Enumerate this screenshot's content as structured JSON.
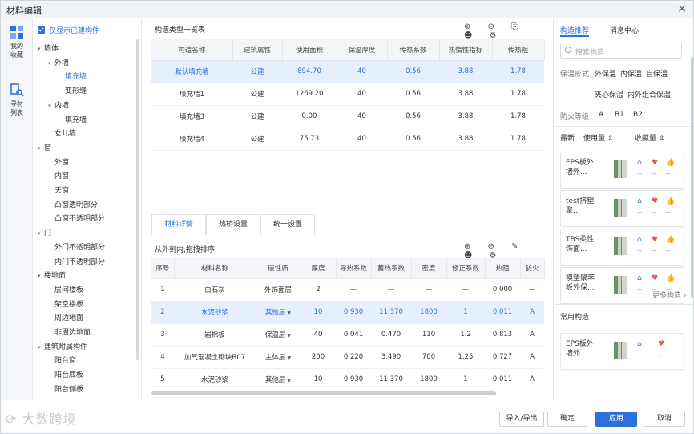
{
  "window": {
    "title": "材料编辑",
    "close": "×"
  },
  "rail": [
    {
      "label1": "我的",
      "label2": "收藏"
    },
    {
      "label1": "寻材",
      "label2": "列表"
    }
  ],
  "tree": {
    "only_built": "仅显示已建构件",
    "nodes": [
      {
        "label": "墙体",
        "level": 0,
        "expand": "▾"
      },
      {
        "label": "外墙",
        "level": 1,
        "expand": "▾"
      },
      {
        "label": "填充墙",
        "level": 2,
        "expand": "",
        "selected": true
      },
      {
        "label": "变形缝",
        "level": 2,
        "expand": ""
      },
      {
        "label": "内墙",
        "level": 1,
        "expand": "▾"
      },
      {
        "label": "填充墙",
        "level": 2,
        "expand": ""
      },
      {
        "label": "女儿墙",
        "level": 1,
        "expand": ""
      },
      {
        "label": "窗",
        "level": 0,
        "expand": "▾"
      },
      {
        "label": "外窗",
        "level": 1,
        "expand": ""
      },
      {
        "label": "内窗",
        "level": 1,
        "expand": ""
      },
      {
        "label": "天窗",
        "level": 1,
        "expand": ""
      },
      {
        "label": "凸窗透明部分",
        "level": 1,
        "expand": ""
      },
      {
        "label": "凸窗不透明部分",
        "level": 1,
        "expand": ""
      },
      {
        "label": "门",
        "level": 0,
        "expand": "▾"
      },
      {
        "label": "外门不透明部分",
        "level": 1,
        "expand": ""
      },
      {
        "label": "内门不透明部分",
        "level": 1,
        "expand": ""
      },
      {
        "label": "楼地面",
        "level": 0,
        "expand": "▾"
      },
      {
        "label": "层间楼板",
        "level": 1,
        "expand": ""
      },
      {
        "label": "架空楼板",
        "level": 1,
        "expand": ""
      },
      {
        "label": "周边地面",
        "level": 1,
        "expand": ""
      },
      {
        "label": "非周边地面",
        "level": 1,
        "expand": ""
      },
      {
        "label": "建筑附属构件",
        "level": 0,
        "expand": "▾"
      },
      {
        "label": "阳台窗",
        "level": 1,
        "expand": ""
      },
      {
        "label": "阳台底板",
        "level": 1,
        "expand": ""
      },
      {
        "label": "阳台侧板",
        "level": 1,
        "expand": ""
      }
    ]
  },
  "types": {
    "title": "构造类型一览表",
    "tools": "⊕ ⊖ ⎘ ☻ ⚙",
    "headers": [
      "构造名称",
      "建筑属性",
      "使用面积",
      "保温厚度",
      "传热系数",
      "热惰性指标",
      "传热阻"
    ],
    "rows": [
      [
        "默认填充墙",
        "公建",
        "894.70",
        "40",
        "0.56",
        "3.88",
        "1.78"
      ],
      [
        "填充墙1",
        "公建",
        "1269.20",
        "40",
        "0.56",
        "3.88",
        "1.78"
      ],
      [
        "填充墙3",
        "公建",
        "0.00",
        "40",
        "0.56",
        "3.88",
        "1.78"
      ],
      [
        "填充墙4",
        "公建",
        "75.73",
        "40",
        "0.56",
        "3.88",
        "1.78"
      ]
    ],
    "highlight": 0
  },
  "tabs": [
    "材料详情",
    "热桥设置",
    "统一设置"
  ],
  "layers": {
    "title": "从外到内,拖拽排序",
    "tools": "⊕ ⊖ ✎ ☻ ⚙",
    "headers": [
      "序号",
      "材料名称",
      "层性质",
      "厚度",
      "导热系数",
      "蓄热系数",
      "密度",
      "修正系数",
      "热阻",
      "防火"
    ],
    "rows": [
      [
        "1",
        "白石灰",
        "外饰面层",
        "2",
        "—",
        "—",
        "—",
        "—",
        "0.000",
        "—"
      ],
      [
        "2",
        "水泥砂浆",
        "其他层",
        "10",
        "0.930",
        "11.370",
        "1800",
        "1",
        "0.011",
        "A"
      ],
      [
        "3",
        "岩棉板",
        "保温层",
        "40",
        "0.041",
        "0.470",
        "110",
        "1.2",
        "0.813",
        "A"
      ],
      [
        "4",
        "加气混凝土砌块B07",
        "主体层",
        "200",
        "0.220",
        "3.490",
        "700",
        "1.25",
        "0.727",
        "A"
      ],
      [
        "5",
        "水泥砂浆",
        "其他层",
        "10",
        "0.930",
        "11.370",
        "1800",
        "1",
        "0.011",
        "A"
      ]
    ],
    "dropdown_rows": [
      1,
      2,
      3,
      4
    ],
    "highlight": 1
  },
  "right": {
    "tabs": [
      "构造推荐",
      "消息中心"
    ],
    "search_placeholder": "搜索构造",
    "form_label": "保温形式",
    "forms": [
      "外保温",
      "内保温",
      "自保温",
      "夹心保温",
      "内外组合保温"
    ],
    "fire_label": "防火等级",
    "fire": [
      "A",
      "B1",
      "B2"
    ],
    "sort": [
      "最新",
      "使用量 ⇕",
      "收藏量 ⇕"
    ],
    "cards": [
      {
        "name1": "EPS板外",
        "name2": "墙外..."
      },
      {
        "name1": "test挤塑",
        "name2": "聚..."
      },
      {
        "name1": "TBS柔性",
        "name2": "饰面..."
      },
      {
        "name1": "模塑聚苯",
        "name2": "板外保..."
      }
    ],
    "dash": "--",
    "more": "更多构造 ›",
    "common_title": "常用构造",
    "common_card": {
      "name1": "EPS板外",
      "name2": "墙外..."
    }
  },
  "footer": {
    "import": "导入/导出",
    "ok": "确定",
    "apply": "应用",
    "cancel": "取消",
    "watermark": "⟳ 大数跨境"
  },
  "colors": {
    "accent": "#2f6fdc"
  }
}
